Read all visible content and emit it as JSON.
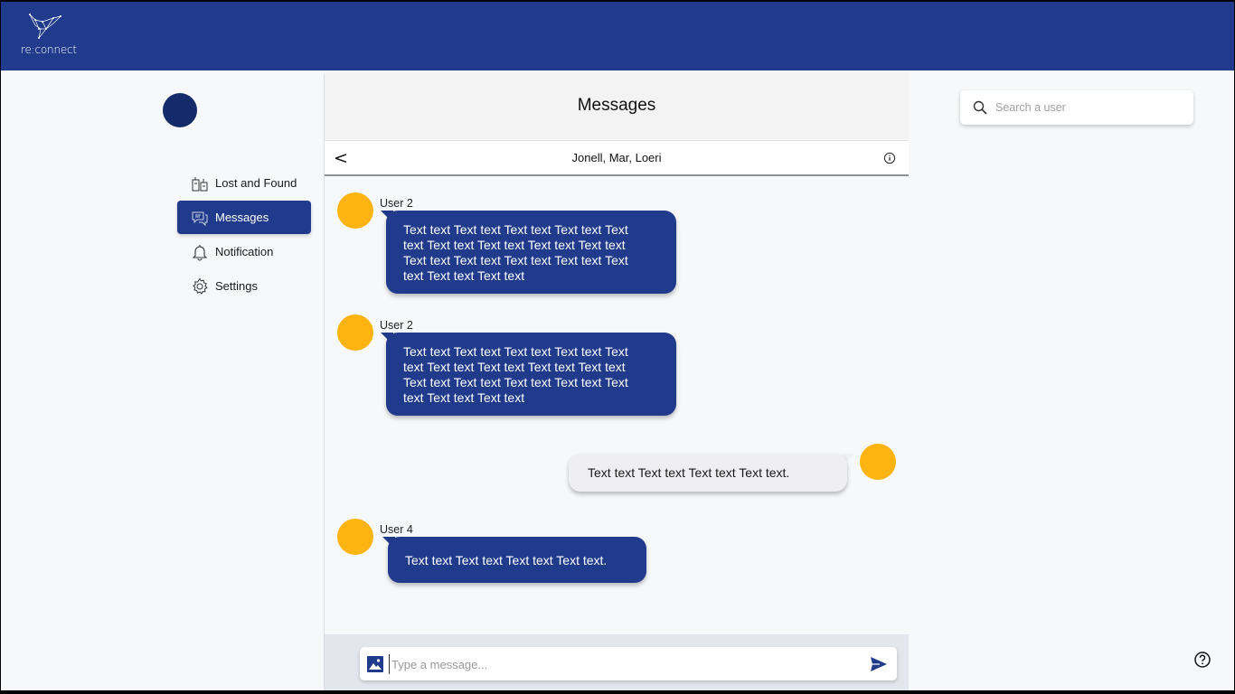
{
  "app": {
    "logo_text": "re:connect"
  },
  "sidebar": {
    "items": [
      {
        "label": "Lost and Found",
        "icon": "lost-found-icon"
      },
      {
        "label": "Messages",
        "icon": "messages-icon",
        "active": true
      },
      {
        "label": "Notification",
        "icon": "bell-icon"
      },
      {
        "label": "Settings",
        "icon": "gear-icon"
      }
    ]
  },
  "chat": {
    "title": "Messages",
    "back_label": "<",
    "conversation_name": "Jonell, Mar, Loeri",
    "messages": [
      {
        "user": "User 2",
        "direction": "in",
        "lines": [
          "Text text Text text Text text Text text Text",
          "text Text text Text text Text text Text text",
          "Text text Text text Text text Text text Text",
          "text Text text Text text"
        ]
      },
      {
        "user": "User 2",
        "direction": "in",
        "lines": [
          "Text text Text text Text text Text text Text",
          "text Text text Text text Text text Text text",
          "Text text Text text Text text Text text Text",
          "text Text text Text text"
        ]
      },
      {
        "user": "",
        "direction": "out",
        "lines": [
          "Text text Text text Text text Text text."
        ]
      },
      {
        "user": "User 4",
        "direction": "in",
        "lines": [
          "Text text Text text Text text Text text."
        ]
      }
    ],
    "composer": {
      "placeholder": "Type a message..."
    }
  },
  "search": {
    "placeholder": "Search a user"
  },
  "colors": {
    "primary": "#213b8c",
    "avatar": "#fdb410",
    "background": "#f7f8fa"
  }
}
